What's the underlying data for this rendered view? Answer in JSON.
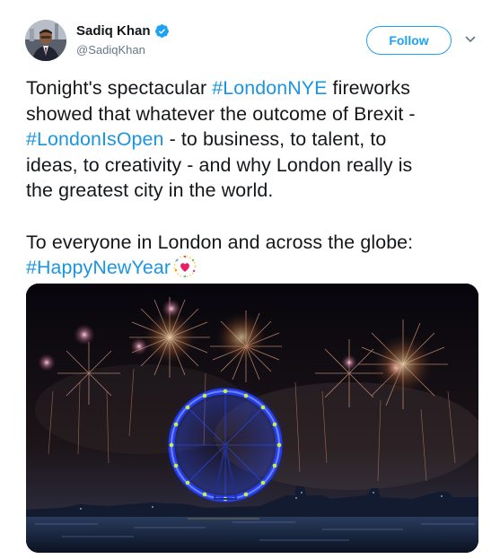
{
  "user": {
    "name": "Sadiq Khan",
    "handle": "@SadiqKhan",
    "verified": true,
    "avatar_icon": "avatar-photo"
  },
  "actions": {
    "follow_label": "Follow",
    "menu_icon": "chevron-down-icon"
  },
  "tweet": {
    "line1_text": "Tonight's spectacular ",
    "line1_hashtag": "#LondonNYE",
    "line1_rest": " fireworks",
    "line2_text": "showed that whatever the outcome of Brexit -",
    "line3_hashtag": "#LondonIsOpen",
    "line3_rest": " - to business, to talent, to",
    "line4_text": "ideas, to creativity - and why London really is",
    "line5_text": "the greatest city in the world.",
    "line6_text": "To everyone in London and across the globe:",
    "line7_hashtag": "#HappyNewYear",
    "emoji": "sparkling-heart-emoji"
  },
  "media": {
    "type": "photo",
    "subject": "fireworks-over-london-eye"
  },
  "colors": {
    "link": "#1b95e0",
    "follow_border": "#1da1f2",
    "handle": "#657786",
    "text": "#14171a",
    "verified": "#1da1f2"
  }
}
